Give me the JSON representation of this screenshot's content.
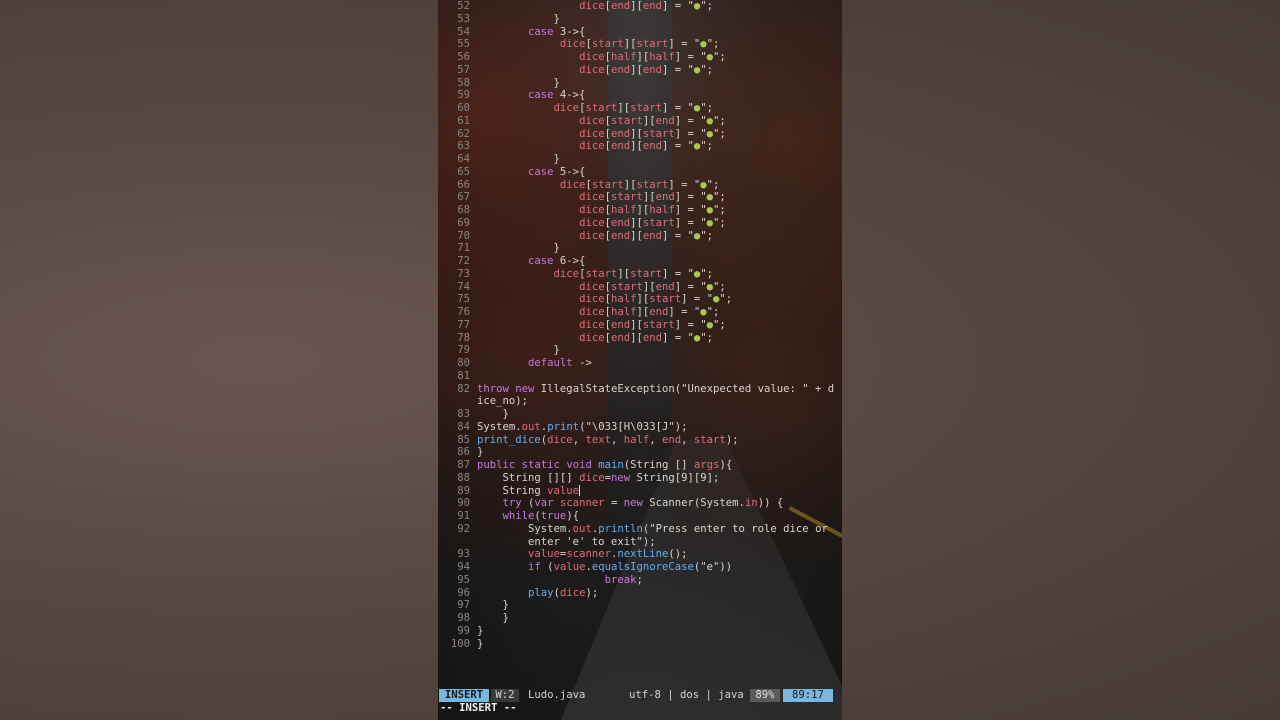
{
  "editor": {
    "lines": [
      {
        "n": "52",
        "t": "                dice[end][end] = \"●\";"
      },
      {
        "n": "53",
        "t": "            }"
      },
      {
        "n": "54",
        "t": "        case 3->{"
      },
      {
        "n": "55",
        "t": "             dice[start][start] = \"●\";"
      },
      {
        "n": "56",
        "t": "                dice[half][half] = \"●\";"
      },
      {
        "n": "57",
        "t": "                dice[end][end] = \"●\";"
      },
      {
        "n": "58",
        "t": "            }"
      },
      {
        "n": "59",
        "t": "        case 4->{"
      },
      {
        "n": "60",
        "t": "            dice[start][start] = \"●\";"
      },
      {
        "n": "61",
        "t": "                dice[start][end] = \"●\";"
      },
      {
        "n": "62",
        "t": "                dice[end][start] = \"●\";"
      },
      {
        "n": "63",
        "t": "                dice[end][end] = \"●\";"
      },
      {
        "n": "64",
        "t": "            }"
      },
      {
        "n": "65",
        "t": "        case 5->{"
      },
      {
        "n": "66",
        "t": "             dice[start][start] = \"●\";"
      },
      {
        "n": "67",
        "t": "                dice[start][end] = \"●\";"
      },
      {
        "n": "68",
        "t": "                dice[half][half] = \"●\";"
      },
      {
        "n": "69",
        "t": "                dice[end][start] = \"●\";"
      },
      {
        "n": "70",
        "t": "                dice[end][end] = \"●\";"
      },
      {
        "n": "71",
        "t": "            }"
      },
      {
        "n": "72",
        "t": "        case 6->{"
      },
      {
        "n": "73",
        "t": "            dice[start][start] = \"●\";"
      },
      {
        "n": "74",
        "t": "                dice[start][end] = \"●\";"
      },
      {
        "n": "75",
        "t": "                dice[half][start] = \"●\";"
      },
      {
        "n": "76",
        "t": "                dice[half][end] = \"●\";"
      },
      {
        "n": "77",
        "t": "                dice[end][start] = \"●\";"
      },
      {
        "n": "78",
        "t": "                dice[end][end] = \"●\";"
      },
      {
        "n": "79",
        "t": "            }"
      },
      {
        "n": "80",
        "t": "        default ->"
      },
      {
        "n": "81",
        "t": ""
      },
      {
        "n": "82",
        "t": "throw new IllegalStateException(\"Unexpected value: \" + d"
      },
      {
        "n": "",
        "t": "ice_no);"
      },
      {
        "n": "83",
        "t": "    }"
      },
      {
        "n": "84",
        "t": "System.out.print(\"\\033[H\\033[J\");"
      },
      {
        "n": "85",
        "t": "print_dice(dice, text, half, end, start);"
      },
      {
        "n": "86",
        "t": "}"
      },
      {
        "n": "87",
        "t": "public static void main(String [] args){"
      },
      {
        "n": "88",
        "t": "    String [][] dice=new String[9][9];"
      },
      {
        "n": "89",
        "t": "    String value",
        "cursor": true
      },
      {
        "n": "90",
        "t": "    try (var scanner = new Scanner(System.in)) {"
      },
      {
        "n": "91",
        "t": "    while(true){"
      },
      {
        "n": "92",
        "t": "        System.out.println(\"Press enter to role dice or"
      },
      {
        "n": "",
        "t": "        enter 'e' to exit\");"
      },
      {
        "n": "93",
        "t": "        value=scanner.nextLine();"
      },
      {
        "n": "94",
        "t": "        if (value.equalsIgnoreCase(\"e\"))"
      },
      {
        "n": "95",
        "t": "                    break;"
      },
      {
        "n": "96",
        "t": "        play(dice);"
      },
      {
        "n": "97",
        "t": "    }"
      },
      {
        "n": "98",
        "t": "    }"
      },
      {
        "n": "99",
        "t": "}"
      },
      {
        "n": "100",
        "t": "}"
      }
    ]
  },
  "statusline": {
    "mode": "INSERT",
    "word_count": "W:2",
    "filename": "Ludo.java",
    "file_info": "utf-8 | dos | java",
    "percent": "89%",
    "position": "89:17"
  },
  "cmdline": "-- INSERT --",
  "colors": {
    "keyword": "#c678dd",
    "variable": "#e06c75",
    "function": "#61afef",
    "dice_dot": "#a8c94a",
    "mode_bg": "#79b6e0"
  }
}
